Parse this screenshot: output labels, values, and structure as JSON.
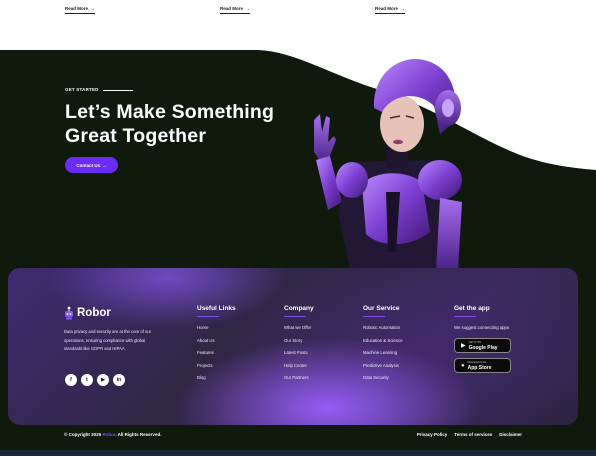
{
  "top_cards": {
    "read_more": [
      "Read More",
      "Read More",
      "Read More"
    ],
    "arrow_icon": "arrow-right"
  },
  "hero": {
    "eyebrow": "GET STARTED",
    "headline_line1": "Let’s Make Something",
    "headline_line2": "Great Together",
    "cta_label": "Contact Us",
    "cta_arrow": "→",
    "image": "purple-female-robot"
  },
  "footer": {
    "brand": "Robor",
    "about": "Data privacy and security are at the core of our operations, ensuring compliance with global standards like GDPR and HIPAA.",
    "socials": [
      {
        "icon": "facebook-icon",
        "glyph": "f"
      },
      {
        "icon": "twitter-icon",
        "glyph": "t"
      },
      {
        "icon": "youtube-icon",
        "glyph": "▶"
      },
      {
        "icon": "linkedin-icon",
        "glyph": "in"
      }
    ],
    "columns": [
      {
        "title": "Useful Links",
        "links": [
          "Home",
          "About Us",
          "Features",
          "Projects",
          "Blog"
        ]
      },
      {
        "title": "Company",
        "links": [
          "What we Offer",
          "Our Story",
          "Latest Posts",
          "Help Center",
          "Our Partners"
        ]
      },
      {
        "title": "Our Service",
        "links": [
          "Robotic Automation",
          "Education & Science",
          "Machine Learning",
          "Predictive Analysis",
          "Data Security"
        ]
      }
    ],
    "app": {
      "title": "Get the app",
      "description": "We suggest connecting apps",
      "google_small": "GET IT ON",
      "google_big": "Google Play",
      "apple_small": "Download on the",
      "apple_big": "App Store"
    },
    "copyright_prefix": "© Copyright 2025",
    "copyright_brand": "Robor",
    "copyright_suffix": ". All Rights Reserved.",
    "legal": [
      "Privacy Policy",
      "Terms of services",
      "Disclaimer"
    ]
  },
  "colors": {
    "accent": "#6b2cf5",
    "dark_background": "#0f1a0d",
    "footer_card": "#3b2a5c"
  }
}
